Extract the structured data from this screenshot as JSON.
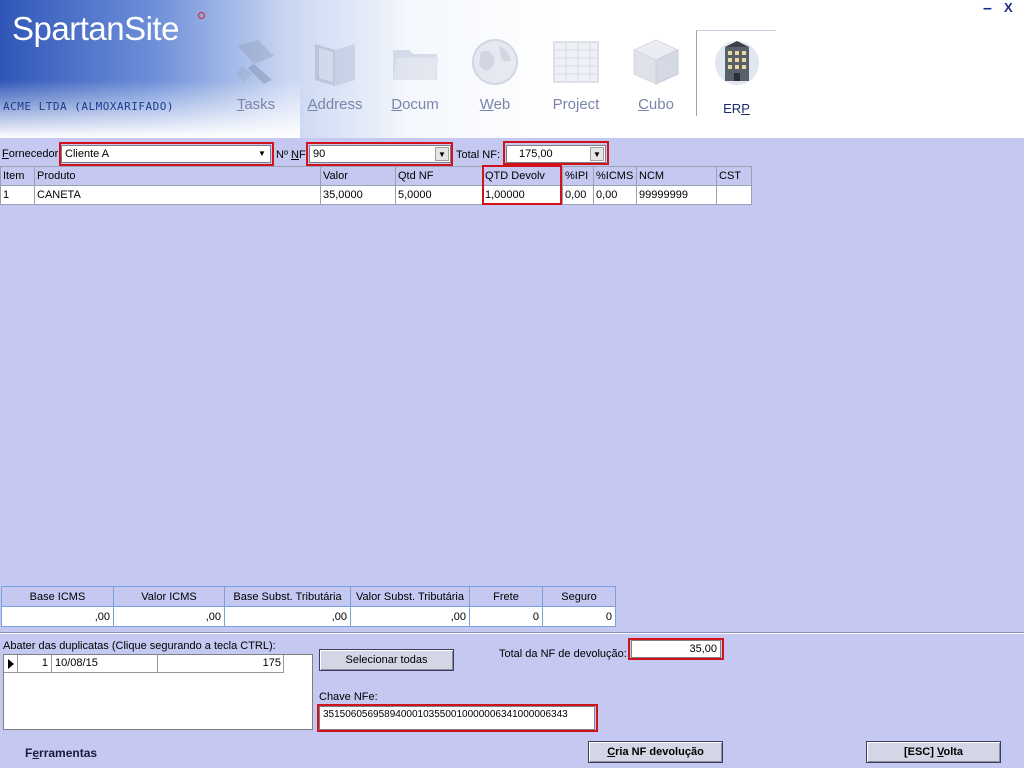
{
  "app": {
    "logo": "SpartanSite",
    "company": "ACME LTDA (ALMOXARIFADO)",
    "minimize": "–",
    "close": "X"
  },
  "nav": [
    {
      "label_first": "T",
      "label_rest": "asks",
      "icon": "tasks-icon"
    },
    {
      "label_first": "A",
      "label_rest": "ddress",
      "icon": "address-book-icon"
    },
    {
      "label_first": "D",
      "label_rest": "ocum",
      "icon": "folder-icon"
    },
    {
      "label_first": "W",
      "label_rest": "eb",
      "icon": "globe-icon"
    },
    {
      "label_first": "Project",
      "label_rest": "",
      "icon": "project-grid-icon"
    },
    {
      "label_first": "C",
      "label_rest": "ubo",
      "icon": "cube-icon"
    },
    {
      "label_first": "ER",
      "label_rest": "P",
      "icon": "building-icon"
    }
  ],
  "form": {
    "fornecedor_label_first": "F",
    "fornecedor_label_rest": "ornecedor",
    "fornecedor_value": "Cliente A",
    "nf_label_a": "Nº ",
    "nf_label_b": "N",
    "nf_label_c": "F",
    "nf_value": "90",
    "total_nf_label": "Total NF:",
    "total_nf_value": "175,00"
  },
  "grid": {
    "headers": [
      "Item",
      "Produto",
      "Valor",
      "Qtd NF",
      "QTD Devolv",
      "%IPI",
      "%ICMS",
      "NCM",
      "CST"
    ],
    "rows": [
      [
        "1",
        "CANETA",
        "35,0000",
        "5,0000",
        "1,00000",
        "0,00",
        "0,00",
        "99999999",
        ""
      ]
    ]
  },
  "totals": {
    "headers": [
      "Base ICMS",
      "Valor ICMS",
      "Base Subst. Tributária",
      "Valor Subst. Tributária",
      "Frete",
      "Seguro"
    ],
    "values": [
      ",00",
      ",00",
      ",00",
      ",00",
      "0",
      "0"
    ]
  },
  "duplicatas": {
    "label": "Abater das duplicatas (Clique segurando a tecla CTRL):",
    "rows": [
      {
        "num": "1",
        "date": "10/08/15",
        "value": "175"
      }
    ]
  },
  "actions": {
    "select_all": "Selecionar todas",
    "total_dev_label": "Total da NF de devolução:",
    "total_dev_value": "35,00",
    "chave_label": "Chave NFe:",
    "chave_value": "35150605695894000103550010000006341000006343",
    "create_btn_first": "C",
    "create_btn_rest": "ria NF devolução",
    "back_btn_a": "[ESC] ",
    "back_btn_b": "V",
    "back_btn_c": "olta",
    "tools_a": "F",
    "tools_b": "e",
    "tools_c": "rramentas"
  }
}
